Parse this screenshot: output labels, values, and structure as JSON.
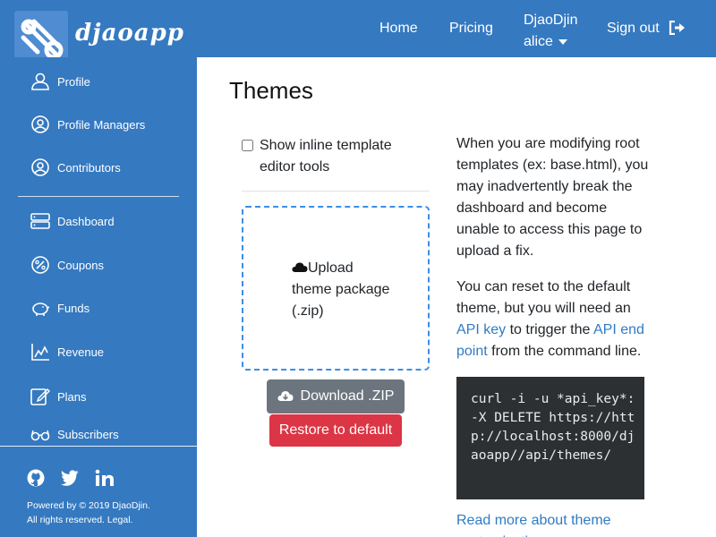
{
  "header": {
    "brand": "djaoapp",
    "nav": {
      "home": "Home",
      "pricing": "Pricing",
      "org": "DjaoDjin",
      "user": "alice",
      "signout": "Sign out"
    }
  },
  "sidebar": {
    "items": [
      {
        "label": "Profile",
        "icon": "user-icon"
      },
      {
        "label": "Profile Managers",
        "icon": "user-circle-icon"
      },
      {
        "label": "Contributors",
        "icon": "user-circle-icon"
      },
      {
        "label": "Dashboard",
        "icon": "server-icon"
      },
      {
        "label": "Coupons",
        "icon": "percent-icon"
      },
      {
        "label": "Funds",
        "icon": "piggy-bank-icon"
      },
      {
        "label": "Revenue",
        "icon": "chart-icon"
      },
      {
        "label": "Plans",
        "icon": "edit-icon"
      },
      {
        "label": "Subscribers",
        "icon": "glasses-icon"
      }
    ],
    "social": [
      "github-icon",
      "twitter-icon",
      "linkedin-icon"
    ],
    "footer_line1": "Powered by © 2019 DjaoDjin.",
    "footer_line2": "All rights reserved. Legal."
  },
  "main": {
    "title": "Themes",
    "checkbox_label": "Show inline template editor tools",
    "checkbox_checked": false,
    "upload_label": "Upload theme package (.zip)",
    "download_label": "Download .ZIP",
    "restore_label": "Restore to default",
    "info_p1": "When you are modifying root templates (ex: base.html), you may inadvertently break the dashboard and become unable to access this page to upload a fix.",
    "info_p2_a": "You can reset to the default theme, but you will need an ",
    "info_p2_link1": "API key",
    "info_p2_b": " to trigger the ",
    "info_p2_link2": "API end point",
    "info_p2_c": " from the command line.",
    "code": "curl -i -u *api_key*: -X DELETE https://http://localhost:8000/djaoapp//api/themes/",
    "read_more": "Read more about theme customization"
  },
  "colors": {
    "primary": "#3579c0",
    "danger": "#dc3545",
    "secondary": "#6c757d",
    "link": "#2f7bc4",
    "code_bg": "#2d3033"
  }
}
